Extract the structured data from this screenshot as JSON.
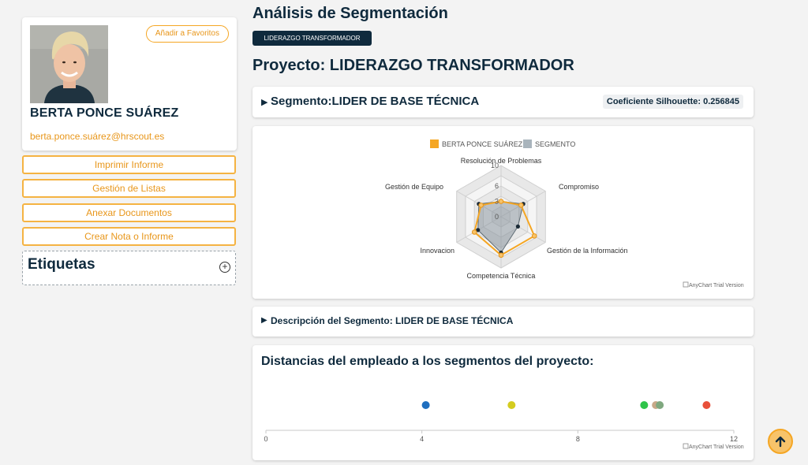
{
  "profile": {
    "favorite_label": "Añadir a Favoritos",
    "name": "BERTA PONCE SUÁREZ",
    "email": "berta.ponce.suárez@hrscout.es"
  },
  "actions": [
    {
      "label": "Imprimir Informe"
    },
    {
      "label": "Gestión de Listas"
    },
    {
      "label": "Anexar Documentos"
    },
    {
      "label": "Crear Nota o Informe"
    }
  ],
  "tags": {
    "title": "Etiquetas"
  },
  "main": {
    "title": "Análisis de Segmentación",
    "project_badge": "LIDERAZGO TRANSFORMADOR",
    "project_title": "Proyecto: LIDERAZGO TRANSFORMADOR",
    "segment_label": "Segmento:LIDER DE BASE TÉCNICA",
    "silhouette": "Coeficiente Silhouette: 0.256845",
    "description_label": "Descripción del Segmento: LIDER DE BASE TÉCNICA",
    "distances_title": "Distancias del empleado a los segmentos del proyecto:",
    "trial_text": "AnyChart Trial Version"
  },
  "colors": {
    "accent": "#f5a623",
    "navy": "#0f2a3d",
    "employee_series": "#f5a623",
    "segment_series": "#a9b4bc"
  },
  "chart_data": [
    {
      "type": "radar",
      "categories": [
        "Resolución de Problemas",
        "Compromiso",
        "Gestión de la Información",
        "Competencia Técnica",
        "Innovacion",
        "Gestión de Equipo"
      ],
      "ylim": [
        0,
        10
      ],
      "ticks": [
        "10",
        "6",
        "3",
        "0"
      ],
      "series": [
        {
          "name": "BERTA PONCE SUÁREZ",
          "values": [
            3,
            4.5,
            7.5,
            7.5,
            6,
            4.5
          ]
        },
        {
          "name": "SEGMENTO",
          "values": [
            3,
            5,
            3.8,
            7,
            5.2,
            5
          ]
        }
      ],
      "legend": "top-center"
    },
    {
      "type": "scatter",
      "xlim": [
        0,
        12
      ],
      "ticks": [
        "0",
        "4",
        "8",
        "12"
      ],
      "points": [
        {
          "x": 4.1,
          "color": "#1f6fbf"
        },
        {
          "x": 6.3,
          "color": "#d4cc1f"
        },
        {
          "x": 9.7,
          "color": "#2fc44a"
        },
        {
          "x": 10.0,
          "color": "#c8a888"
        },
        {
          "x": 10.1,
          "color": "#7fa87f"
        },
        {
          "x": 11.3,
          "color": "#e8503a"
        }
      ]
    }
  ]
}
